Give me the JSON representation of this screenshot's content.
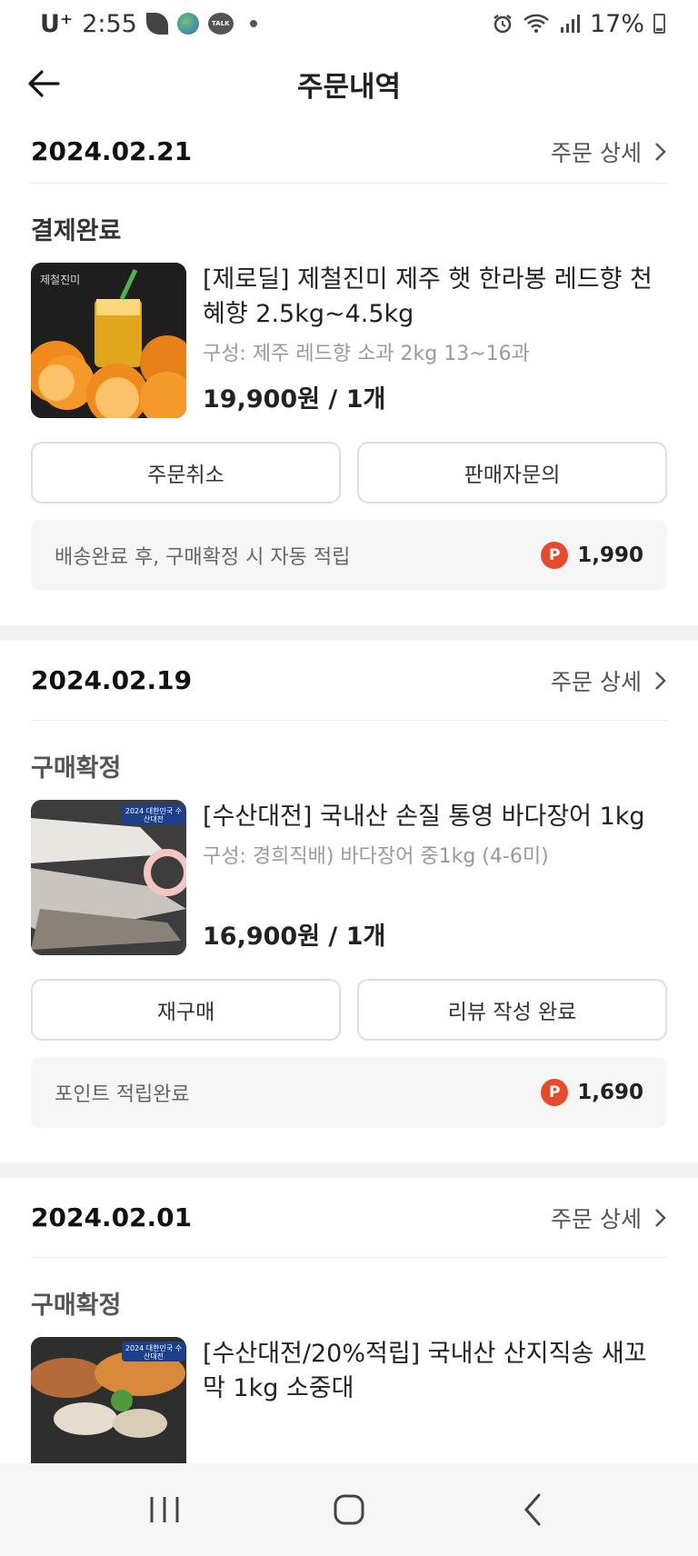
{
  "status_bar": {
    "carrier": "U⁺",
    "time": "2:55",
    "battery": "17%",
    "icons": [
      "leaf-icon",
      "globe-icon",
      "talk-icon",
      "notification-dot-icon",
      "alarm-icon",
      "wifi-icon",
      "signal-icon",
      "battery-icon"
    ]
  },
  "header": {
    "title": "주문내역",
    "back_icon": "arrow-left-icon"
  },
  "orders": [
    {
      "date": "2024.02.21",
      "detail_label": "주문 상세",
      "status": "결제완료",
      "product_name": "[제로딜] 제철진미 제주 햇 한라봉 레드향 천혜향 2.5kg~4.5kg",
      "option": "구성: 제주 레드향 소과 2kg 13~16과",
      "price": "19,900원 / 1개",
      "thumb_brand": "제철진미",
      "buttons": [
        "주문취소",
        "판매자문의"
      ],
      "point_text": "배송완료 후, 구매확정 시 자동 적립",
      "point_badge": "P",
      "point_value": "1,990"
    },
    {
      "date": "2024.02.19",
      "detail_label": "주문 상세",
      "status": "구매확정",
      "product_name": "[수산대전] 국내산 손질 통영 바다장어 1kg",
      "option": "구성: 경희직배) 바다장어 중1kg (4-6미)",
      "price": "16,900원 / 1개",
      "thumb_brand": "2024 대한민국 수산대전",
      "buttons": [
        "재구매",
        "리뷰 작성 완료"
      ],
      "point_text": "포인트 적립완료",
      "point_badge": "P",
      "point_value": "1,690"
    },
    {
      "date": "2024.02.01",
      "detail_label": "주문 상세",
      "status": "구매확정",
      "product_name": "[수산대전/20%적립] 국내산 산지직송 새꼬막 1kg 소중대",
      "thumb_brand": "2024 대한민국 수산대전"
    }
  ],
  "nav": {
    "recent_icon": "recent-apps-icon",
    "home_icon": "home-icon",
    "back_icon": "back-icon"
  },
  "colors": {
    "point_badge": "#e8492b",
    "divider": "#ececec",
    "section_gap": "#f2f2f2"
  }
}
